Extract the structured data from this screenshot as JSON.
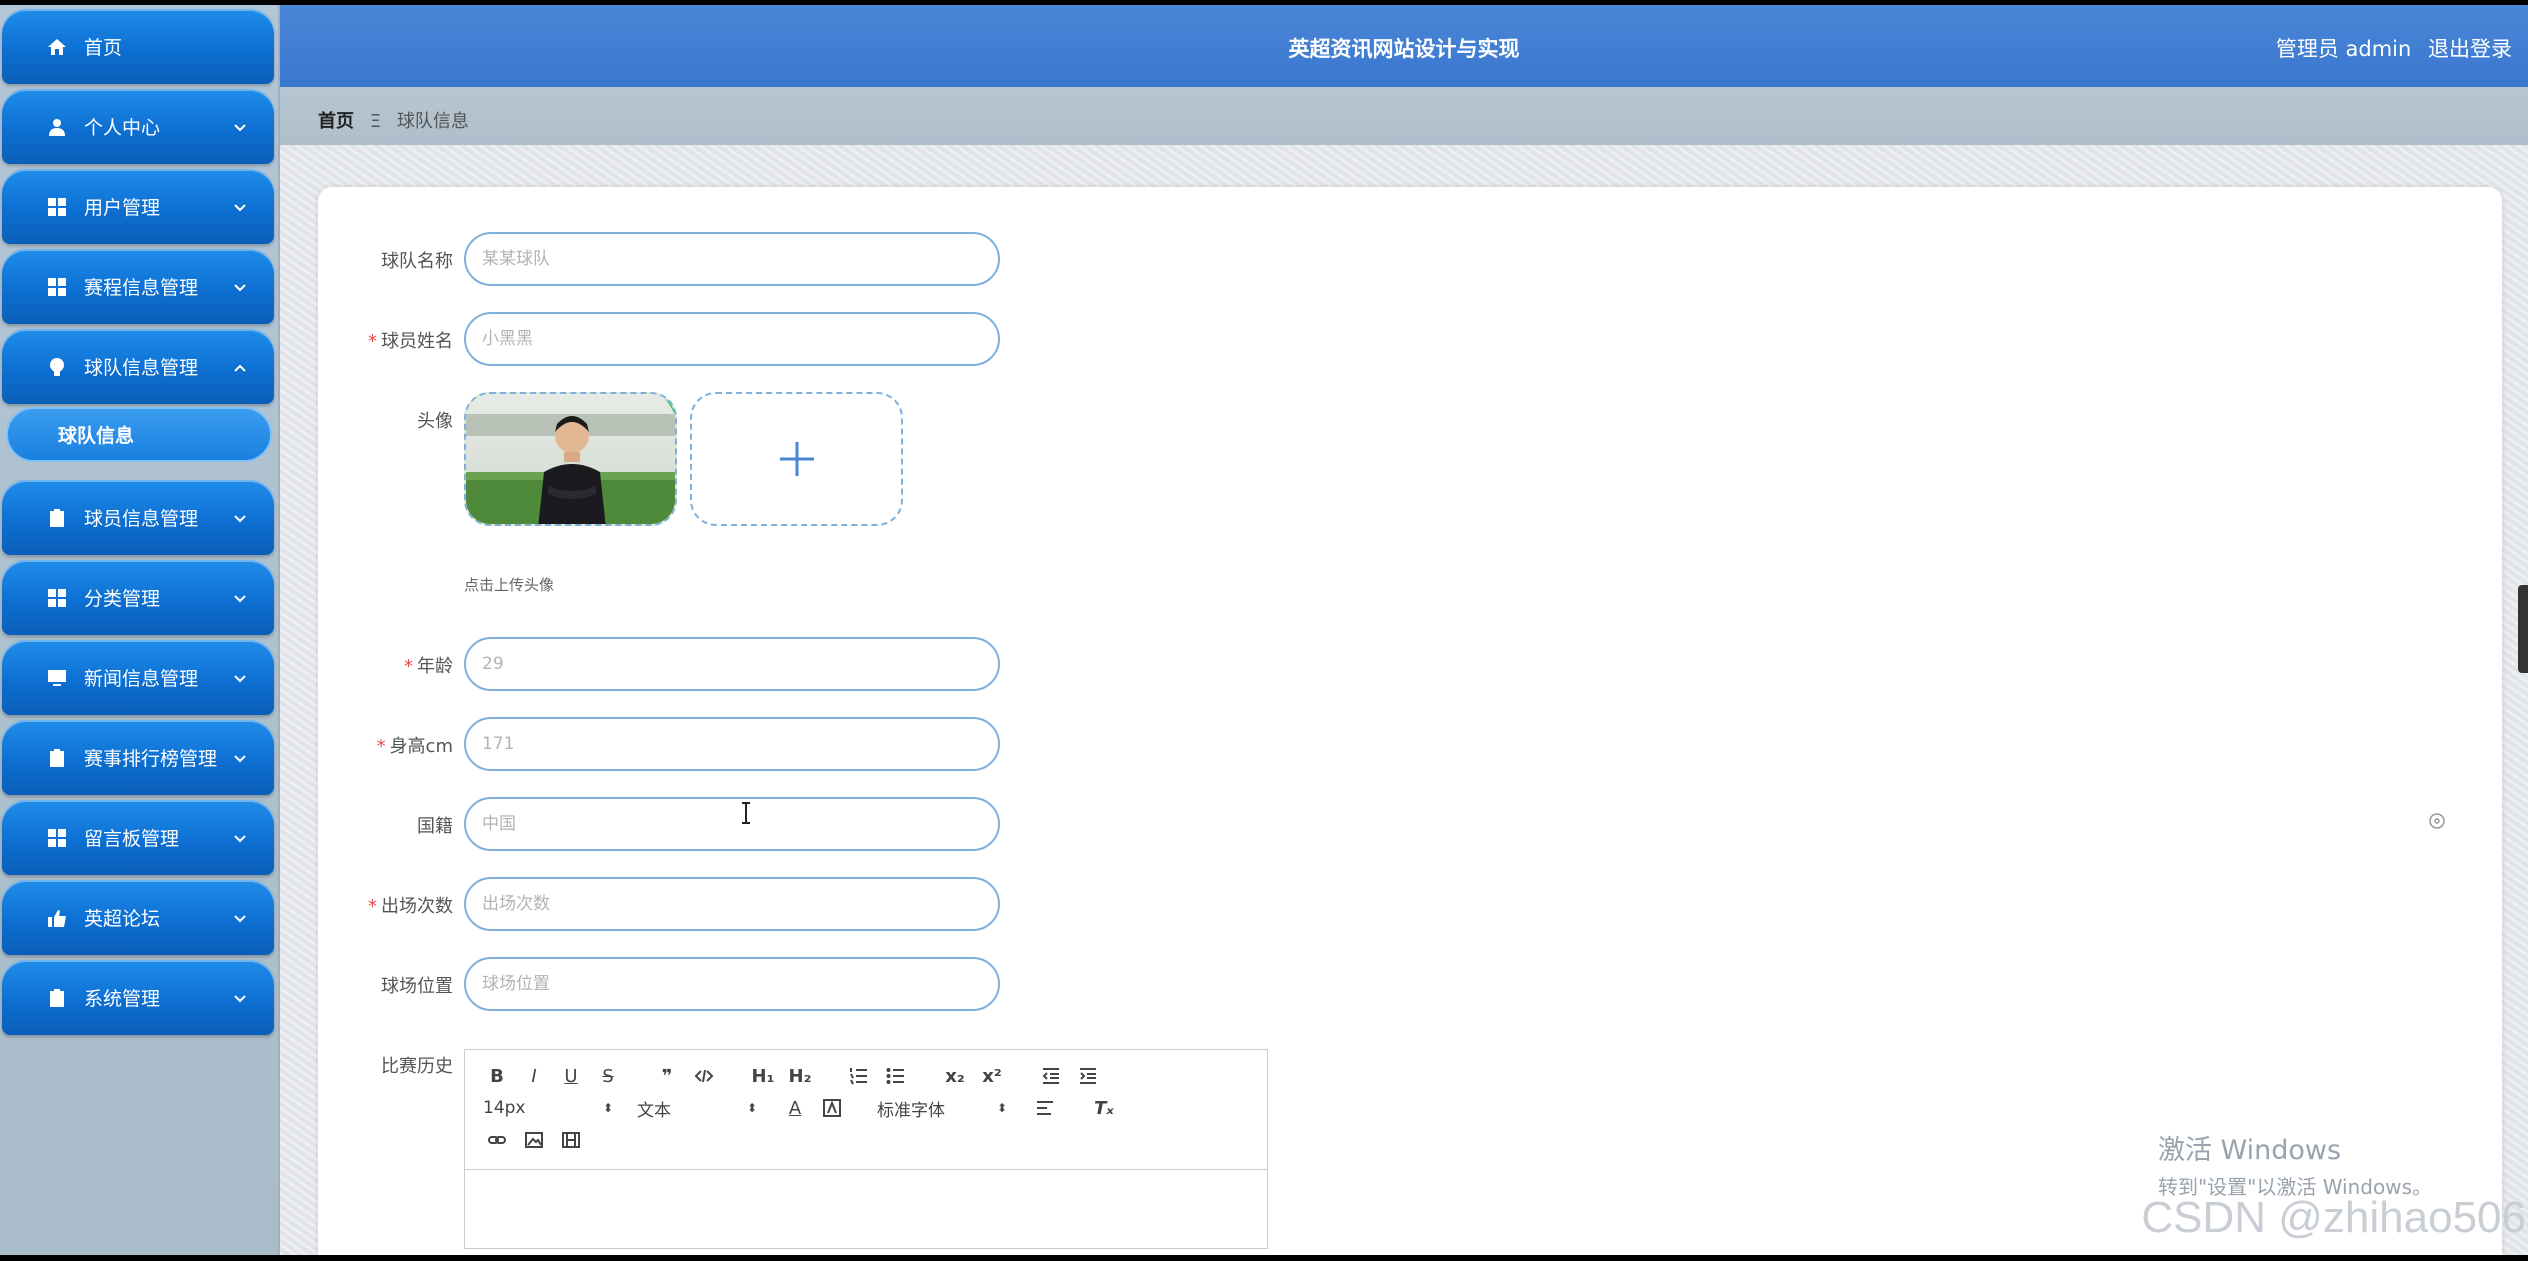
{
  "header": {
    "title": "英超资讯网站设计与实现",
    "user_label": "管理员 admin",
    "logout_label": "退出登录"
  },
  "breadcrumb": {
    "home": "首页",
    "separator": "Ξ",
    "current": "球队信息"
  },
  "sidebar": {
    "items": [
      {
        "label": "首页",
        "icon": "home-icon",
        "has_chevron": false
      },
      {
        "label": "个人中心",
        "icon": "user-icon",
        "has_chevron": true
      },
      {
        "label": "用户管理",
        "icon": "grid-icon",
        "has_chevron": true
      },
      {
        "label": "赛程信息管理",
        "icon": "grid-icon",
        "has_chevron": true
      },
      {
        "label": "球队信息管理",
        "icon": "bulb-icon",
        "has_chevron": true,
        "expanded": true
      },
      {
        "label": "球员信息管理",
        "icon": "clipboard-icon",
        "has_chevron": true
      },
      {
        "label": "分类管理",
        "icon": "grid-icon",
        "has_chevron": true
      },
      {
        "label": "新闻信息管理",
        "icon": "monitor-icon",
        "has_chevron": true
      },
      {
        "label": "赛事排行榜管理",
        "icon": "clipboard-x-icon",
        "has_chevron": true
      },
      {
        "label": "留言板管理",
        "icon": "grid-icon",
        "has_chevron": true
      },
      {
        "label": "英超论坛",
        "icon": "thumbs-up-icon",
        "has_chevron": true
      },
      {
        "label": "系统管理",
        "icon": "clipboard-icon",
        "has_chevron": true
      }
    ],
    "sub_item": "球队信息"
  },
  "form": {
    "team_name": {
      "label": "球队名称",
      "required": false,
      "placeholder": "某某球队"
    },
    "player_name": {
      "label": "球员姓名",
      "required": true,
      "placeholder": "小黑黑"
    },
    "avatar": {
      "label": "头像",
      "hint": "点击上传头像"
    },
    "age": {
      "label": "年龄",
      "required": true,
      "placeholder": "29"
    },
    "height": {
      "label": "身高cm",
      "required": true,
      "placeholder": "171"
    },
    "nationality": {
      "label": "国籍",
      "required": false,
      "placeholder": "中国"
    },
    "appearances": {
      "label": "出场次数",
      "required": true,
      "placeholder": "出场次数"
    },
    "position": {
      "label": "球场位置",
      "required": false,
      "placeholder": "球场位置"
    },
    "history": {
      "label": "比赛历史"
    }
  },
  "editor": {
    "font_size": "14px",
    "text_style": "文本",
    "font_family": "标准字体"
  },
  "watermark": {
    "line1": "激活 Windows",
    "line2": "转到\"设置\"以激活 Windows。"
  },
  "csdn": "CSDN @zhihao506",
  "colors": {
    "nav_blue": "#0d6fd2",
    "header_blue": "#3a78cf",
    "required_red": "#e84a4a",
    "input_border": "#7fb0dc"
  }
}
